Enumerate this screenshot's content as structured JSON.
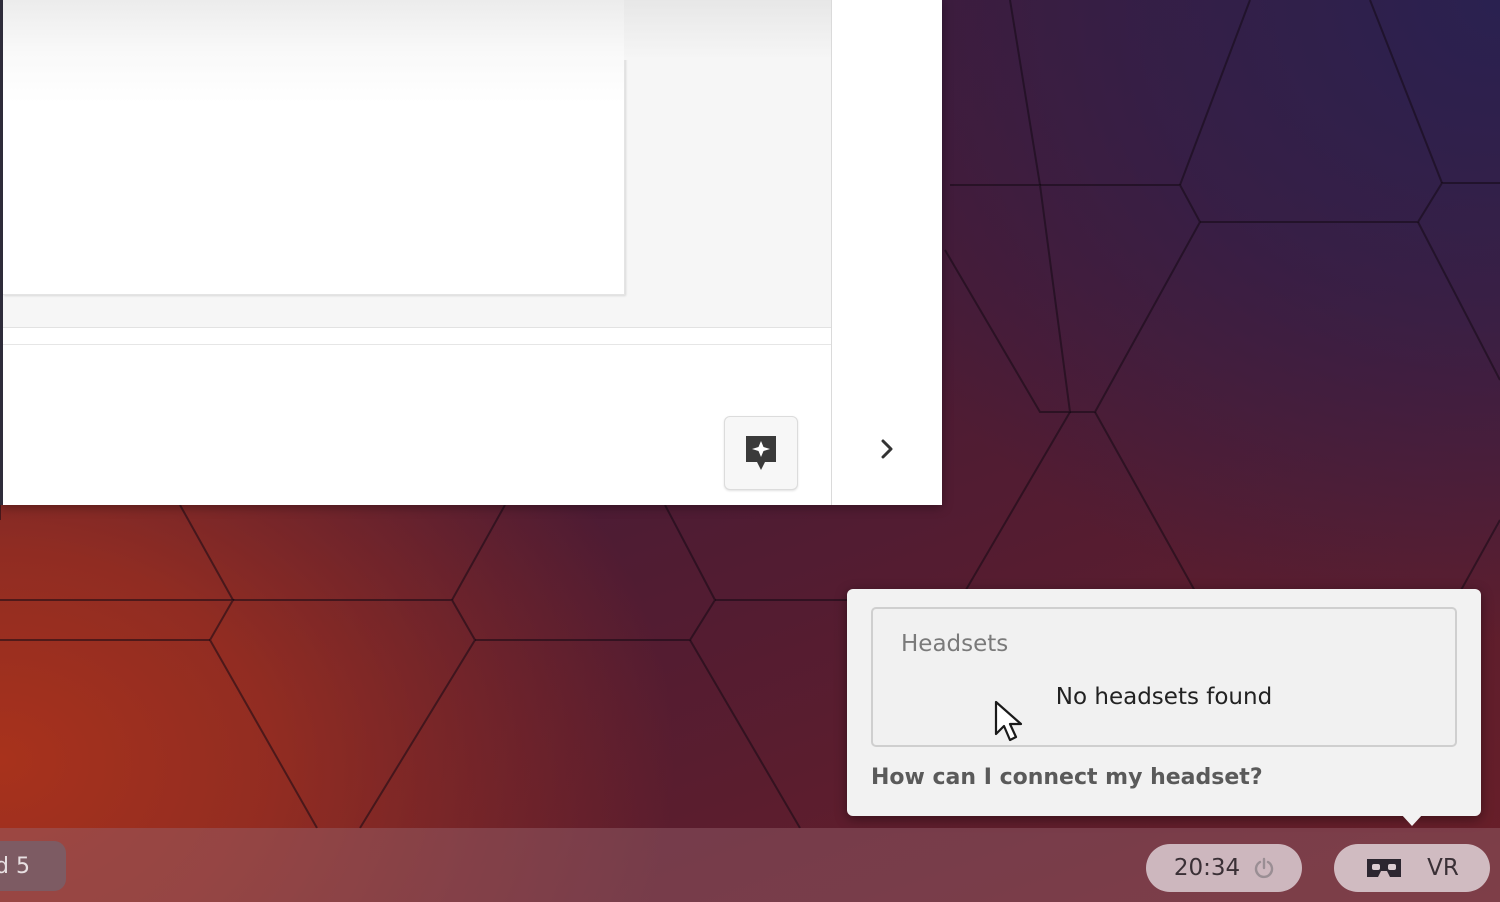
{
  "vr_popover": {
    "section_title": "Headsets",
    "empty_message": "No headsets found",
    "help_link": "How can I connect my headset?"
  },
  "taskbar": {
    "workspace_label": "d 5",
    "clock": "20:34",
    "vr_label": "VR"
  },
  "icons": {
    "sparkle": "sparkle-icon",
    "chevron": "chevron-right-icon",
    "power": "power-icon",
    "vr_headset": "vr-headset-icon",
    "cursor": "mouse-cursor-icon"
  },
  "colors": {
    "popover_bg": "#f2f2f2",
    "link_text": "#5a5a5a",
    "pill_bg": "#dccdd2"
  }
}
